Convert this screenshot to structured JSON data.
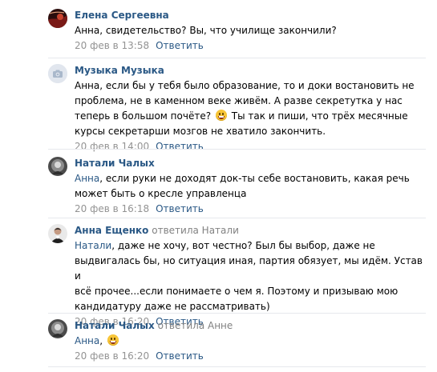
{
  "reply_label": "Ответить",
  "comments": [
    {
      "author": "Елена Сергеевна",
      "text": "Анна, свидетельство? Вы, что училище закончили?",
      "date": "20 фев в 13:58"
    },
    {
      "author": "Музыка Музыка",
      "text_1": "Анна, если бы у тебя было образование, то и доки востановить не\nпроблема, не в каменном веке живём. А разве секретутка у нас\nтеперь в большом почёте?",
      "text_2": "Ты так и пиши, что трёх месячные\nкурсы секретарши мозгов не хватило закончить.",
      "emoji": "grinning-face-emoji",
      "date": "20 фев в 14:00"
    },
    {
      "author": "Натали Чалых",
      "mention": "Анна",
      "text": ", если руки не доходят док-ты себе востановить, какая речь\nможет быть о кресле управленца",
      "date": "20 фев в 16:18"
    },
    {
      "author": "Анна Ещенко",
      "reply_to": "ответила Натали",
      "mention": "Натали",
      "text": ", даже не хочу, вот честно? Был бы выбор, даже не\nвыдвигалась бы, но ситуация иная, партия обязует, мы идём. Устав и\nвсё прочее...если понимаете о чем я. Поэтому и призываю мою\nкандидатуру даже не рассматривать)",
      "date": "20 фев в 16:20"
    },
    {
      "author": "Натали Чалых",
      "reply_to": "ответила Анне",
      "mention": "Анна",
      "text": ",",
      "emoji": "grinning-face-emoji",
      "date": "20 фев в 16:20"
    }
  ],
  "colors": {
    "link": "#2a5885",
    "meta": "#939393",
    "divider": "#e7e8ec"
  }
}
